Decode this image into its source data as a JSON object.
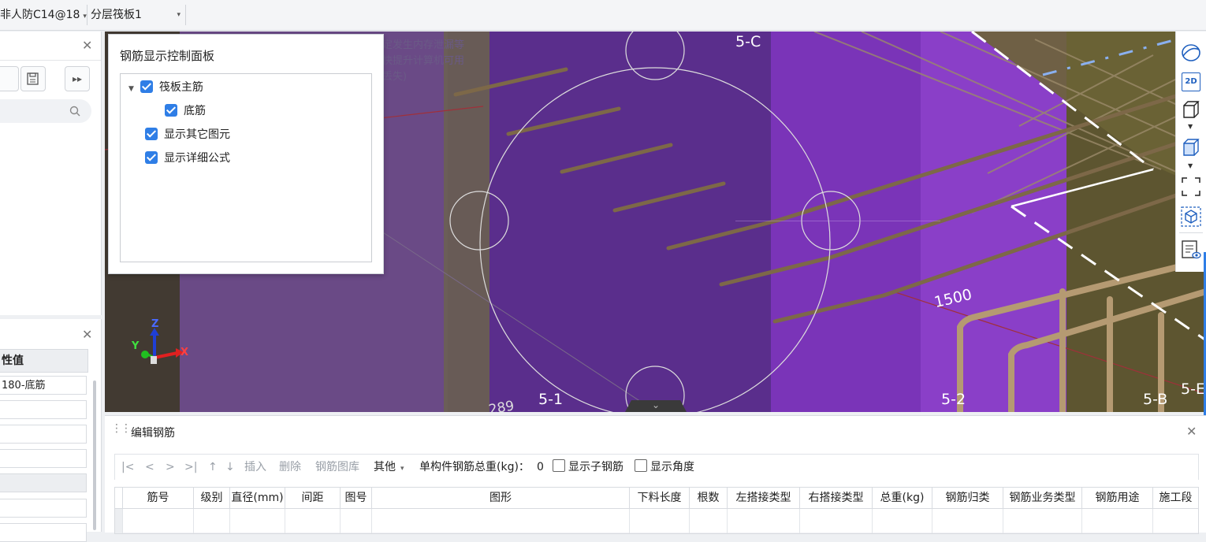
{
  "topbar": {
    "rebar_select": "非人防C14@18",
    "layer_select": "分层筏板1"
  },
  "left_panel": {
    "props_header": "性值",
    "rows": [
      "180-底筋",
      "",
      "",
      "",
      "",
      "",
      ""
    ]
  },
  "viewport": {
    "warning_lines": [
      "定发生内存泄漏等",
      "快提升计算机可用",
      "丢失)"
    ],
    "axis_labels": [
      "5-C",
      "5-1",
      "5-2",
      "5-B",
      "5-E"
    ],
    "dimension": "1500",
    "dimension2": "289",
    "gizmo": {
      "x": "X",
      "y": "Y",
      "z": "Z"
    }
  },
  "control_panel": {
    "title": "钢筋显示控制面板",
    "items": [
      {
        "label": "筏板主筋",
        "checked": true
      },
      {
        "label": "底筋",
        "checked": true
      },
      {
        "label": "显示其它图元",
        "checked": true
      },
      {
        "label": "显示详细公式",
        "checked": true
      }
    ]
  },
  "right_toolbar": {
    "items": [
      "orbit-icon",
      "view-2d-icon",
      "cube-view-icon",
      "cube-solid-icon",
      "fullscreen-icon",
      "isolate-icon",
      "display-settings-icon"
    ],
    "view_2d_label": "2D"
  },
  "editor": {
    "title": "编辑钢筋",
    "nav": [
      "|<",
      "<",
      ">",
      ">|",
      "↑",
      "↓"
    ],
    "insert": "插入",
    "delete": "删除",
    "library": "钢筋图库",
    "other": "其他",
    "total_weight_label": "单构件钢筋总重(kg)：",
    "total_weight_value": "0",
    "show_sub_rebar": "显示子钢筋",
    "show_angle": "显示角度",
    "columns": [
      "筋号",
      "级别",
      "直径(mm)",
      "间距",
      "图号",
      "图形",
      "下料长度",
      "根数",
      "左搭接类型",
      "右搭接类型",
      "总重(kg)",
      "钢筋归类",
      "钢筋业务类型",
      "钢筋用途",
      "施工段"
    ]
  }
}
